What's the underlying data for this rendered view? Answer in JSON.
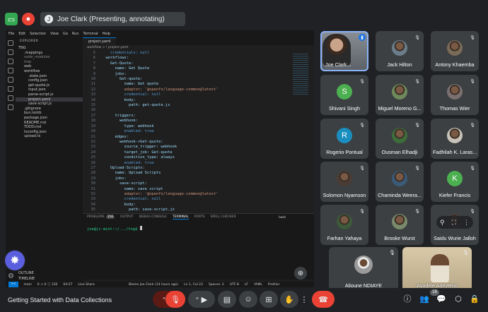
{
  "topbar": {
    "presenting_label": "Joe Clark (Presenting, annotating)",
    "presenter_initial": "J"
  },
  "vscode": {
    "menu": [
      "File",
      "Edit",
      "Selection",
      "View",
      "Go",
      "Run",
      "Terminal",
      "Help"
    ],
    "explorer_title": "EXPLORER",
    "root": "TNG",
    "files": [
      ".mappings",
      "node_modules",
      "tmp",
      "web",
      "workflow",
      ".state.json",
      "config.json",
      "get-quote.js",
      "input.json",
      "parse-script.js",
      "project.yaml",
      "save-script.js",
      ".gitignore",
      "bun.lockb",
      "package.json",
      "README.md",
      "TODO.md",
      "tsconfig.json",
      "upload.ts"
    ],
    "selected_file": "project.yaml",
    "outline_label": "OUTLINE",
    "timeline_label": "TIMELINE",
    "tab_label": "project.yaml",
    "breadcrumb": "workflow  >  ! project.yaml",
    "code_lines": [
      {
        "n": "5",
        "t": "    credentials: null"
      },
      {
        "n": "6",
        "t": "  workflows:"
      },
      {
        "n": "7",
        "t": "    Get-Quote:"
      },
      {
        "n": "8",
        "t": "      name: Get Quote"
      },
      {
        "n": "9",
        "t": "      jobs:"
      },
      {
        "n": "10",
        "t": "        Get-quote:"
      },
      {
        "n": "11",
        "t": "          name: Get quote"
      },
      {
        "n": "12",
        "t": "          adaptor: '@openfn/language-common@latest'"
      },
      {
        "n": "13",
        "t": "          credential: null"
      },
      {
        "n": "14",
        "t": "          body:"
      },
      {
        "n": "15",
        "t": "            path: get-quote.js"
      },
      {
        "n": "16",
        "t": ""
      },
      {
        "n": "17",
        "t": "      triggers:"
      },
      {
        "n": "18",
        "t": "        webhook:"
      },
      {
        "n": "19",
        "t": "          type: webhook"
      },
      {
        "n": "20",
        "t": "          enabled: true"
      },
      {
        "n": "21",
        "t": "      edges:"
      },
      {
        "n": "22",
        "t": "        webhook->Get-quote:"
      },
      {
        "n": "23",
        "t": "          source_trigger: webhook"
      },
      {
        "n": "24",
        "t": "          target_job: Get-quote"
      },
      {
        "n": "25",
        "t": "          condition_type: always"
      },
      {
        "n": "26",
        "t": "          enabled: true"
      },
      {
        "n": "27",
        "t": "    Upload-Scripts:"
      },
      {
        "n": "28",
        "t": "      name: Upload Scripts"
      },
      {
        "n": "29",
        "t": "      jobs:"
      },
      {
        "n": "30",
        "t": "        save-script:"
      },
      {
        "n": "31",
        "t": "          name: save script"
      },
      {
        "n": "32",
        "t": "          adaptor: '@openfn/language-common@latest'"
      },
      {
        "n": "33",
        "t": "          credential: null"
      },
      {
        "n": "34",
        "t": "          body:"
      },
      {
        "n": "35",
        "t": "            path: save-script.js"
      }
    ],
    "panel_tabs": [
      "PROBLEMS",
      "OUTPUT",
      "DEBUG CONSOLE",
      "TERMINAL",
      "PORTS",
      "SPELL CHECKER"
    ],
    "active_panel_tab": "TERMINAL",
    "problems_count": "156",
    "terminal_name": "bash",
    "terminal_prompt": "joe@jc-mint:~/.../tng$",
    "status": {
      "branch": "main",
      "errors": "0 ⚠ 0 ⓘ 130",
      "time": "04:27",
      "live_share": "Live Share",
      "blame": "Blame Joe Clark (14 hours ago)",
      "position": "Ln 1, Col 23",
      "spaces": "Spaces: 2",
      "encoding": "UTF-8",
      "eol": "LF",
      "lang": "YAML",
      "formatter": "Prettier"
    }
  },
  "participants": [
    {
      "name": "Joe Clark...",
      "initial": "J",
      "color": "#5b4636",
      "type": "photo",
      "mic": "speaking"
    },
    {
      "name": "Jack Hilton",
      "initial": "J",
      "color": "#6b7d8a",
      "type": "photo",
      "mic": "muted"
    },
    {
      "name": "Antony Khaemba",
      "initial": "A",
      "color": "#7a6a58",
      "type": "photo",
      "mic": "muted"
    },
    {
      "name": "Shivani Singh",
      "initial": "S",
      "color": "#4caf50",
      "type": "letter",
      "mic": "muted"
    },
    {
      "name": "Miguel Moreno G...",
      "initial": "M",
      "color": "#6f8a5a",
      "type": "photo",
      "mic": "muted"
    },
    {
      "name": "Thomas Wier",
      "initial": "T",
      "color": "#7a7070",
      "type": "photo",
      "mic": "muted"
    },
    {
      "name": "Rogerio Pontual",
      "initial": "R",
      "color": "#1a8fbf",
      "type": "letter",
      "mic": "muted"
    },
    {
      "name": "Ousman Elhadji",
      "initial": "O",
      "color": "#3d6e3a",
      "type": "photo",
      "mic": "muted"
    },
    {
      "name": "Fadhilah K. Laras...",
      "initial": "F",
      "color": "#c8c2b8",
      "type": "photo",
      "mic": "muted"
    },
    {
      "name": "Solomon Nyamson",
      "initial": "S",
      "color": "#4a3c35",
      "type": "photo",
      "mic": "muted"
    },
    {
      "name": "Chaminda Weera...",
      "initial": "C",
      "color": "#3a5a78",
      "type": "photo",
      "mic": "muted"
    },
    {
      "name": "Kiefer Francis",
      "initial": "K",
      "color": "#4caf50",
      "type": "letter",
      "mic": "muted"
    },
    {
      "name": "Farhan Yahaya",
      "initial": "F",
      "color": "#3d5a3a",
      "type": "photo",
      "mic": "muted"
    },
    {
      "name": "Brooke Wurst",
      "initial": "B",
      "color": "#7a8a6a",
      "type": "photo",
      "mic": "muted"
    },
    {
      "name": "Saidu Wurie Jalloh",
      "initial": "S",
      "color": "#4a4040",
      "type": "photo",
      "mic": "muted"
    }
  ],
  "large_tiles": [
    {
      "name": "Alioune NDIAYE",
      "color": "#3c4043"
    },
    {
      "name": "Ayodele Adeyemo",
      "color": "#d8c9a8"
    }
  ],
  "meeting_title": "Getting Started with Data Collections",
  "people_count": "18",
  "colors": {
    "end_call": "#ea4335",
    "mic_off": "#ea4335",
    "accent": "#8ab4f8",
    "fab": "#5b5fde"
  }
}
